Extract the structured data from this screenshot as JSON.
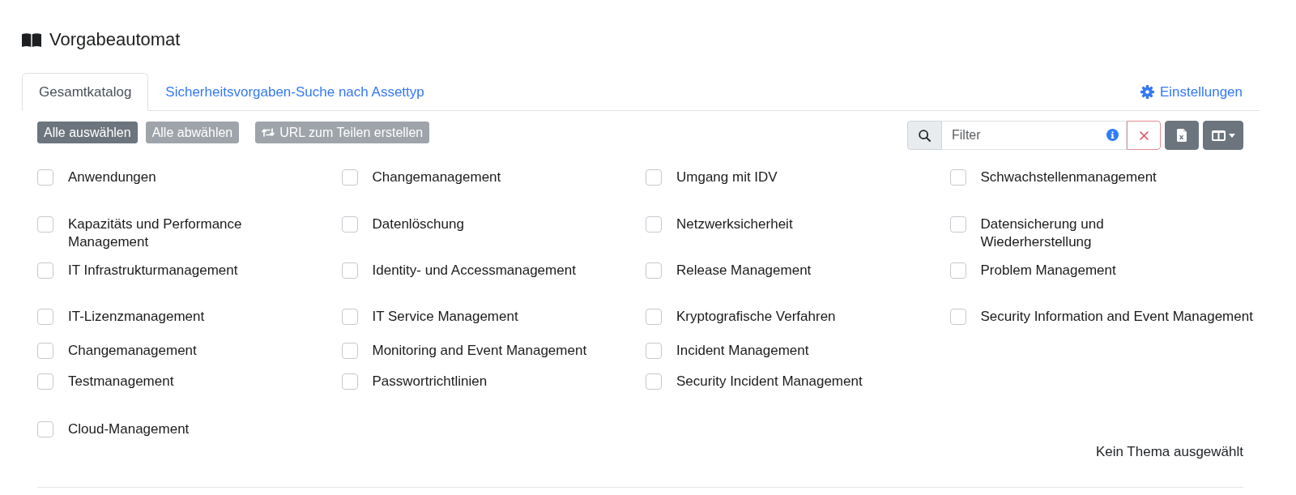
{
  "title": {
    "text": "Vorgabeautomat"
  },
  "tabs": [
    {
      "label": "Gesamtkatalog",
      "selected": true
    },
    {
      "label": "Sicherheitsvorgaben-Suche nach Assettyp",
      "selected": false
    }
  ],
  "settings_link": {
    "label": "Einstellungen"
  },
  "selection_buttons": [
    {
      "label": "Alle auswählen",
      "disabled": false
    },
    {
      "label": "Alle abwählen",
      "disabled": true
    }
  ],
  "share_button": {
    "label": "URL zum Teilen erstellen",
    "disabled": true
  },
  "filter": {
    "placeholder": "Filter"
  },
  "topic_columns": [
    {
      "topics": [
        {
          "label": "Anwendungen",
          "checked": false
        },
        {
          "label": "Kapazitäts und Performance\nManagement",
          "checked": false
        },
        {
          "label": "IT Infrastrukturmanagement",
          "checked": false
        },
        {
          "label": "IT-Lizenzmanagement",
          "checked": false
        },
        {
          "label": "Changemanagement",
          "checked": false
        },
        {
          "label": "Testmanagement",
          "checked": false
        },
        {
          "label": "Cloud-Management",
          "checked": false
        }
      ]
    },
    {
      "topics": [
        {
          "label": "Changemanagement",
          "checked": false
        },
        {
          "label": "Datenlöschung",
          "checked": false
        },
        {
          "label": "Identity- und Accessmanagement",
          "checked": false
        },
        {
          "label": "IT Service Management",
          "checked": false
        },
        {
          "label": "Monitoring and Event Management",
          "checked": false
        },
        {
          "label": "Passwortrichtlinien",
          "checked": false
        }
      ]
    },
    {
      "topics": [
        {
          "label": "Umgang mit IDV",
          "checked": false
        },
        {
          "label": "Netzwerksicherheit",
          "checked": false
        },
        {
          "label": "Release Management",
          "checked": false
        },
        {
          "label": "Kryptografische Verfahren",
          "checked": false
        },
        {
          "label": "Incident Management",
          "checked": false
        },
        {
          "label": "Security Incident Management",
          "checked": false
        }
      ]
    },
    {
      "topics": [
        {
          "label": "Schwachstellenmanagement",
          "checked": false
        },
        {
          "label": "Datensicherung und\nWiederherstellung",
          "checked": false
        },
        {
          "label": "Problem Management",
          "checked": false
        },
        {
          "label": "Security Information and Event Management",
          "checked": false
        }
      ]
    }
  ],
  "status_text": "Kein Thema ausgewählt"
}
